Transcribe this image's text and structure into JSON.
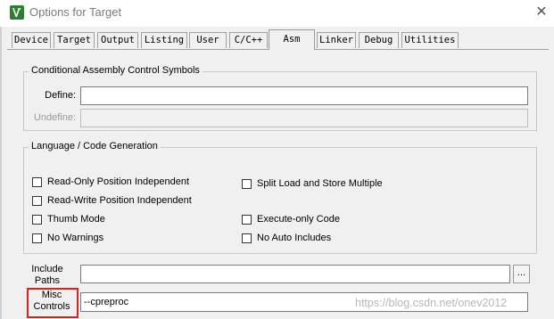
{
  "window": {
    "title": "Options for Target",
    "close_glyph": "✕",
    "icon": "uvision-icon"
  },
  "tabs": [
    {
      "label": "Device",
      "active": false
    },
    {
      "label": "Target",
      "active": false
    },
    {
      "label": "Output",
      "active": false
    },
    {
      "label": "Listing",
      "active": false
    },
    {
      "label": "User",
      "active": false
    },
    {
      "label": "C/C++",
      "active": false
    },
    {
      "label": "Asm",
      "active": true
    },
    {
      "label": "Linker",
      "active": false
    },
    {
      "label": "Debug",
      "active": false
    },
    {
      "label": "Utilities",
      "active": false
    }
  ],
  "conditional_assembly": {
    "title": "Conditional Assembly Control Symbols",
    "define_label": "Define:",
    "define_value": "",
    "undefine_label": "Undefine:",
    "undefine_value": ""
  },
  "language_code_gen": {
    "title": "Language / Code Generation",
    "checkboxes": [
      {
        "label": "Read-Only Position Independent",
        "checked": false
      },
      {
        "label": "Read-Write Position Independent",
        "checked": false
      },
      {
        "label": "Thumb Mode",
        "checked": false
      },
      {
        "label": "No Warnings",
        "checked": false
      },
      {
        "label": "Split Load and Store Multiple",
        "checked": false
      },
      {
        "label": "Execute-only Code",
        "checked": false
      },
      {
        "label": "No Auto Includes",
        "checked": false
      }
    ]
  },
  "include_paths": {
    "label_line1": "Include",
    "label_line2": "Paths",
    "value": "",
    "browse_label": "..."
  },
  "misc_controls": {
    "label_line1": "Misc",
    "label_line2": "Controls",
    "value": "--cpreproc",
    "highlight_color": "#e02020"
  },
  "watermark": "https://blog.csdn.net/onev2012"
}
